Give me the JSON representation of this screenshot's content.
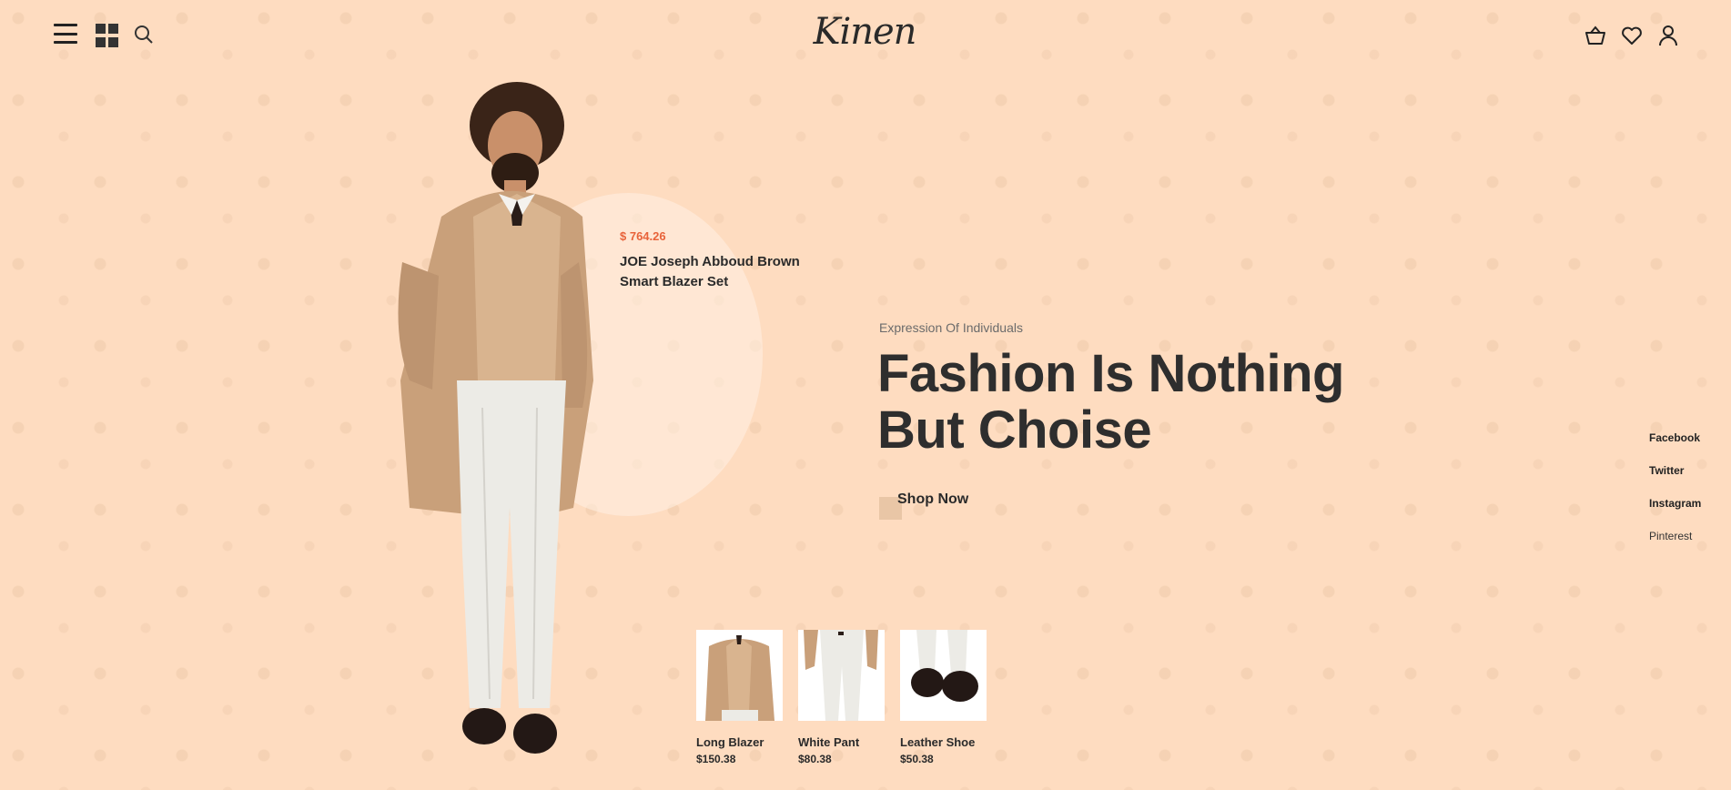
{
  "header": {
    "logo_text": "Kinen",
    "icons": [
      "menu-icon",
      "grid-icon",
      "search-icon",
      "basket-icon",
      "heart-icon",
      "user-icon"
    ]
  },
  "featured": {
    "price": "$ 764.26",
    "name": "JOE Joseph Abboud Brown Smart Blazer Set"
  },
  "hero": {
    "subtitle": "Expression Of Individuals",
    "headline": "Fashion Is Nothing But Choise",
    "cta_label": "Shop Now"
  },
  "social": [
    "Facebook",
    "Twitter",
    "Instagram",
    "Pinterest"
  ],
  "products": [
    {
      "name": "Long Blazer",
      "price": "$150.38"
    },
    {
      "name": "White Pant",
      "price": "$80.38"
    },
    {
      "name": "Leather Shoe",
      "price": "$50.38"
    }
  ],
  "colors": {
    "background": "#fedcc0",
    "accent_price": "#e8633a",
    "text": "#2e2e2e",
    "blazer": "#c9a07a",
    "pants": "#ecebe6"
  }
}
